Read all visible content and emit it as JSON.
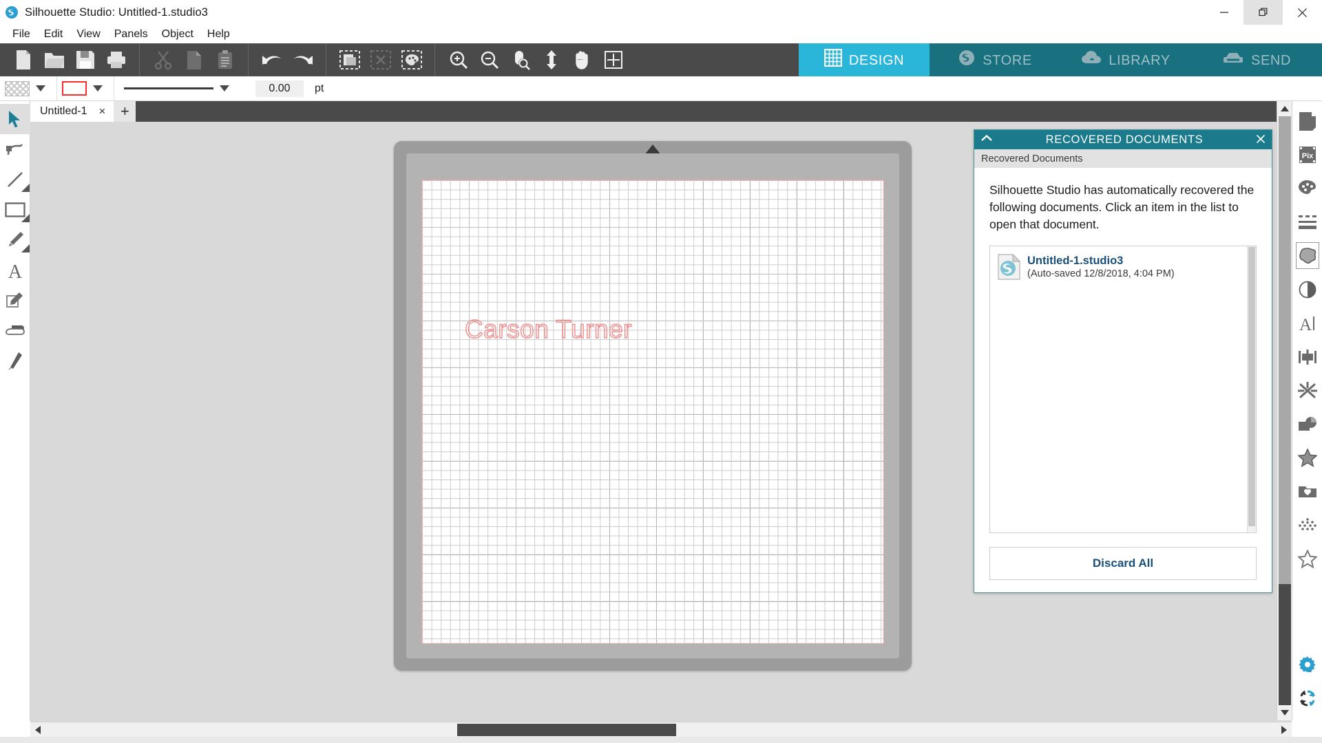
{
  "window": {
    "app_name": "Silhouette Studio",
    "title": "Silhouette Studio: Untitled-1.studio3",
    "minimize_label": "Minimize",
    "restore_label": "Restore Down",
    "close_label": "Close",
    "tooltip": "Restore Down"
  },
  "menubar": {
    "items": [
      {
        "label": "File"
      },
      {
        "label": "Edit"
      },
      {
        "label": "View"
      },
      {
        "label": "Panels"
      },
      {
        "label": "Object"
      },
      {
        "label": "Help"
      }
    ]
  },
  "toolbar": {
    "groups": [
      {
        "buttons": [
          {
            "name": "new-document-icon",
            "label": "New"
          },
          {
            "name": "open-document-icon",
            "label": "Open"
          },
          {
            "name": "save-document-icon",
            "label": "Save"
          },
          {
            "name": "print-icon",
            "label": "Print"
          }
        ]
      },
      {
        "buttons": [
          {
            "name": "cut-scissors-icon",
            "label": "Cut"
          },
          {
            "name": "copy-icon",
            "label": "Copy"
          },
          {
            "name": "paste-clipboard-icon",
            "label": "Paste"
          }
        ]
      },
      {
        "buttons": [
          {
            "name": "undo-icon",
            "label": "Undo"
          },
          {
            "name": "redo-icon",
            "label": "Redo"
          }
        ]
      },
      {
        "buttons": [
          {
            "name": "select-all-icon",
            "label": "Select All"
          },
          {
            "name": "deselect-all-icon",
            "label": "Deselect All"
          },
          {
            "name": "select-by-color-icon",
            "label": "Select by Color"
          }
        ]
      },
      {
        "buttons": [
          {
            "name": "zoom-in-icon",
            "label": "Zoom In"
          },
          {
            "name": "zoom-out-icon",
            "label": "Zoom Out"
          },
          {
            "name": "zoom-selection-icon",
            "label": "Zoom to Selection"
          },
          {
            "name": "fit-to-window-icon",
            "label": "Fit To Window"
          },
          {
            "name": "pan-hand-icon",
            "label": "Pan"
          },
          {
            "name": "show-grid-icon",
            "label": "Show Grid"
          }
        ]
      }
    ]
  },
  "nav": {
    "tabs": [
      {
        "label": "DESIGN",
        "icon": "grid-icon",
        "active": true,
        "bg": "#2ab6d9",
        "fg": "#ffffff"
      },
      {
        "label": "STORE",
        "icon": "silhouette-s-icon",
        "active": false,
        "bg": "#19707f",
        "fg": "#9dbfc6"
      },
      {
        "label": "LIBRARY",
        "icon": "cloud-icon",
        "active": false,
        "bg": "#19707f",
        "fg": "#9dbfc6"
      },
      {
        "label": "SEND",
        "icon": "cutter-icon",
        "active": false,
        "bg": "#19707f",
        "fg": "#9dbfc6"
      }
    ]
  },
  "style_bar": {
    "fill_swatch_name": "fill-color-swatch",
    "fill_value": "none",
    "stroke_swatch_name": "line-color-swatch",
    "stroke_color": "#ff2b2b",
    "line_style_name": "line-style-preview",
    "line_width_value": "0.00",
    "line_width_placeholder": "0.00",
    "unit_label": "pt"
  },
  "left_tools": [
    {
      "name": "select-tool",
      "label": "Select",
      "icon": "cursor-arrow-icon",
      "selected": true,
      "has_submenu": false
    },
    {
      "name": "edit-points-tool",
      "label": "Edit Points",
      "icon": "node-edit-icon",
      "selected": false,
      "has_submenu": false
    },
    {
      "name": "line-tool",
      "label": "Draw a Line",
      "icon": "line-icon",
      "selected": false,
      "has_submenu": true
    },
    {
      "name": "rectangle-tool",
      "label": "Draw a Rectangle",
      "icon": "rectangle-icon",
      "selected": false,
      "has_submenu": true
    },
    {
      "name": "draw-freehand-tool",
      "label": "Draw Freehand",
      "icon": "pencil-icon",
      "selected": false,
      "has_submenu": true
    },
    {
      "name": "text-tool",
      "label": "Draw a Text",
      "icon": "text-a-icon",
      "selected": false,
      "has_submenu": false
    },
    {
      "name": "trace-tool",
      "label": "Trace",
      "icon": "trace-icon",
      "selected": false,
      "has_submenu": false
    },
    {
      "name": "eraser-tool",
      "label": "Eraser",
      "icon": "eraser-icon",
      "selected": false,
      "has_submenu": false
    },
    {
      "name": "knife-tool",
      "label": "Knife",
      "icon": "knife-icon",
      "selected": false,
      "has_submenu": false
    }
  ],
  "document_tabs": {
    "tabs": [
      {
        "label": "Untitled-1",
        "close": "×",
        "active": true
      }
    ],
    "add_label": "+"
  },
  "canvas": {
    "text_objects": [
      {
        "name": "canvas-text-object",
        "text": "Carson Turner",
        "stroke_color": "#f08b8b"
      }
    ],
    "mat_name": "cutting-mat",
    "page_name": "design-page"
  },
  "recovered_panel": {
    "title": "RECOVERED DOCUMENTS",
    "collapse_icon": "chevron-up-icon",
    "close_icon": "close-icon",
    "subheader": "Recovered Documents",
    "message": "Silhouette Studio has automatically recovered the following documents. Click an item in the list to open that document.",
    "documents": [
      {
        "name": "Untitled-1.studio3",
        "meta": "(Auto-saved 12/8/2018, 4:04 PM)",
        "icon": "studio3-file-icon"
      }
    ],
    "discard_label": "Discard All",
    "accent_color": "#1b7b8c",
    "link_color": "#1a4f7a"
  },
  "right_panels": [
    {
      "name": "page-setup-panel-button",
      "label": "Page Setup",
      "icon": "page-icon"
    },
    {
      "name": "pixscan-panel-button",
      "label": "PixScan",
      "icon": "pix-icon"
    },
    {
      "name": "fill-panel-button",
      "label": "Fill",
      "icon": "palette-icon"
    },
    {
      "name": "line-style-panel-button",
      "label": "Line Style",
      "icon": "line-style-icon"
    },
    {
      "name": "trace-panel-button",
      "label": "Trace",
      "icon": "trace-shape-icon",
      "selected": true
    },
    {
      "name": "transparency-panel-button",
      "label": "Transparency",
      "icon": "contrast-circle-icon"
    },
    {
      "name": "text-style-panel-button",
      "label": "Text Style",
      "icon": "text-cursor-icon"
    },
    {
      "name": "align-panel-button",
      "label": "Align",
      "icon": "align-icon"
    },
    {
      "name": "modify-panel-button",
      "label": "Modify",
      "icon": "modify-icon"
    },
    {
      "name": "offset-panel-button",
      "label": "Offset",
      "icon": "offset-icon"
    },
    {
      "name": "sketch-panel-button",
      "label": "Sketch",
      "icon": "star-filled-icon"
    },
    {
      "name": "library-panel-button",
      "label": "Library",
      "icon": "heart-card-icon"
    },
    {
      "name": "stipple-panel-button",
      "label": "Stipple",
      "icon": "dots-icon"
    },
    {
      "name": "shapes-panel-button",
      "label": "Shapes",
      "icon": "star-outline-icon"
    }
  ],
  "right_rail_bottom": [
    {
      "name": "preferences-button",
      "label": "Preferences",
      "icon": "gear-icon",
      "color": "#2a9fd0"
    },
    {
      "name": "sync-button",
      "label": "Sync",
      "icon": "sync-refresh-icon",
      "color": "#2a9fd0"
    }
  ],
  "scrollbars": {
    "vertical_name": "canvas-vertical-scrollbar",
    "horizontal_name": "canvas-horizontal-scrollbar"
  }
}
